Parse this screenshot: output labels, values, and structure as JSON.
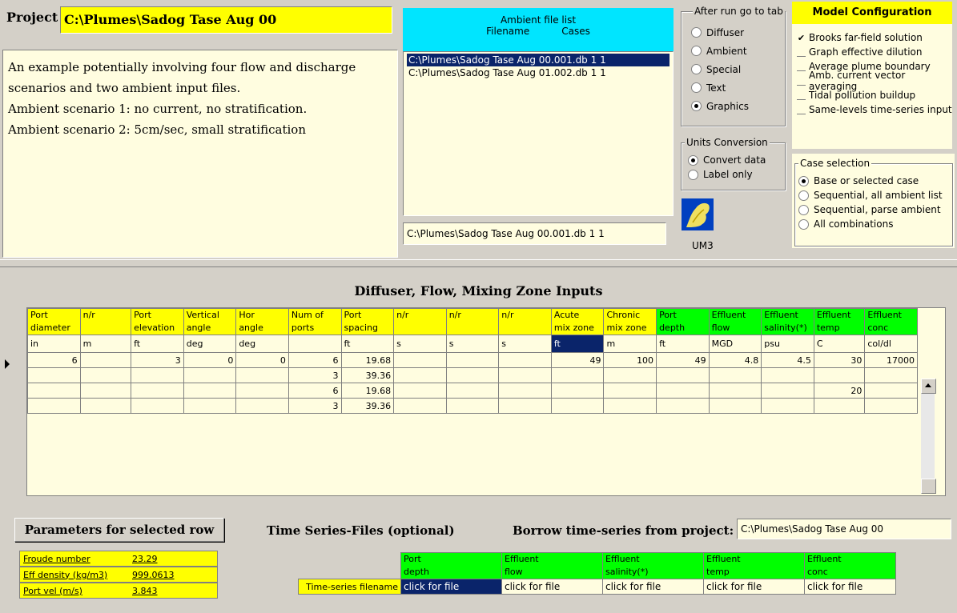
{
  "project": {
    "label": "Project",
    "path": "C:\\Plumes\\Sadog Tase Aug 00",
    "description": [
      "An example potentially involving four flow and discharge",
      "scenarios and two ambient input files.",
      "Ambient scenario 1: no current, no stratification.",
      "Ambient scenario 2: 5cm/sec, small stratification"
    ]
  },
  "ambient_list": {
    "title": "Ambient file list",
    "col_filename": "Filename",
    "col_cases": "Cases",
    "items": [
      "C:\\Plumes\\Sadog Tase Aug 00.001.db 1 1",
      "C:\\Plumes\\Sadog Tase Aug 01.002.db 1 1"
    ],
    "selected_index": 0,
    "current": "C:\\Plumes\\Sadog Tase Aug 00.001.db 1 1"
  },
  "after_run": {
    "title": "After run go to tab",
    "options": [
      "Diffuser",
      "Ambient",
      "Special",
      "Text",
      "Graphics"
    ],
    "selected": "Graphics"
  },
  "units_conversion": {
    "title": "Units Conversion",
    "options": [
      "Convert data",
      "Label only"
    ],
    "selected": "Convert data"
  },
  "um3_label": "UM3",
  "model_config": {
    "title": "Model Configuration",
    "options": [
      {
        "label": "Brooks far-field solution",
        "checked": true
      },
      {
        "label": "Graph effective dilution",
        "checked": false
      },
      {
        "label": "Average plume boundary",
        "checked": false
      },
      {
        "label": "Amb. current vector averaging",
        "checked": false
      },
      {
        "label": "Tidal pollution buildup",
        "checked": false
      },
      {
        "label": "Same-levels time-series input",
        "checked": false
      }
    ]
  },
  "case_selection": {
    "title": "Case selection",
    "options": [
      "Base or selected case",
      "Sequential, all ambient list",
      "Sequential, parse ambient",
      "All combinations"
    ],
    "selected": "Base or selected case"
  },
  "diffuser": {
    "title": "Diffuser, Flow, Mixing Zone Inputs",
    "columns": [
      {
        "h1": "Port",
        "h2": "diameter",
        "unit": "in",
        "color": "#ffff00"
      },
      {
        "h1": "n/r",
        "h2": "",
        "unit": "m",
        "color": "#ffff00"
      },
      {
        "h1": "Port",
        "h2": "elevation",
        "unit": "ft",
        "color": "#ffff00"
      },
      {
        "h1": "Vertical",
        "h2": "angle",
        "unit": "deg",
        "color": "#ffff00"
      },
      {
        "h1": "Hor",
        "h2": "angle",
        "unit": "deg",
        "color": "#ffff00"
      },
      {
        "h1": "Num of",
        "h2": "ports",
        "unit": "",
        "color": "#ffff00"
      },
      {
        "h1": "Port",
        "h2": "spacing",
        "unit": "ft",
        "color": "#ffff00"
      },
      {
        "h1": "n/r",
        "h2": "",
        "unit": "s",
        "color": "#ffff00"
      },
      {
        "h1": "n/r",
        "h2": "",
        "unit": "s",
        "color": "#ffff00"
      },
      {
        "h1": "n/r",
        "h2": "",
        "unit": "s",
        "color": "#ffff00"
      },
      {
        "h1": "Acute",
        "h2": "mix zone",
        "unit": "ft",
        "color": "#ffff00"
      },
      {
        "h1": "Chronic",
        "h2": "mix zone",
        "unit": "m",
        "color": "#ffff00"
      },
      {
        "h1": "Port",
        "h2": "depth",
        "unit": "ft",
        "color": "#00ff00"
      },
      {
        "h1": "Effluent",
        "h2": "flow",
        "unit": "MGD",
        "color": "#00ff00"
      },
      {
        "h1": "Effluent",
        "h2": "salinity(*)",
        "unit": "psu",
        "color": "#00ff00"
      },
      {
        "h1": "Effluent",
        "h2": "temp",
        "unit": "C",
        "color": "#00ff00"
      },
      {
        "h1": "Effluent",
        "h2": "conc",
        "unit": "col/dl",
        "color": "#00ff00"
      }
    ],
    "selected_unit_col": 10,
    "rows": [
      [
        "6",
        "",
        "3",
        "0",
        "0",
        "6",
        "19.68",
        "",
        "",
        "",
        "49",
        "100",
        "49",
        "4.8",
        "4.5",
        "30",
        "17000"
      ],
      [
        "",
        "",
        "",
        "",
        "",
        "3",
        "39.36",
        "",
        "",
        "",
        "",
        "",
        "",
        "",
        "",
        "",
        ""
      ],
      [
        "",
        "",
        "",
        "",
        "",
        "6",
        "19.68",
        "",
        "",
        "",
        "",
        "",
        "",
        "",
        "",
        "20",
        ""
      ],
      [
        "",
        "",
        "",
        "",
        "",
        "3",
        "39.36",
        "",
        "",
        "",
        "",
        "",
        "",
        "",
        "",
        "",
        ""
      ]
    ]
  },
  "params": {
    "title": "Parameters for selected row",
    "rows": [
      {
        "label": "Froude number",
        "value": "23.29"
      },
      {
        "label": "Eff density (kg/m3)",
        "value": "999.0613"
      },
      {
        "label": "Port vel (m/s)",
        "value": "3.843"
      }
    ]
  },
  "timeseries": {
    "title": "Time Series-Files (optional)",
    "borrow_label": "Borrow time-series from project:",
    "borrow_value": "C:\\Plumes\\Sadog Tase Aug 00",
    "row_label": "Time-series filename",
    "columns": [
      {
        "h1": "Port",
        "h2": "depth"
      },
      {
        "h1": "Effluent",
        "h2": "flow"
      },
      {
        "h1": "Effluent",
        "h2": "salinity(*)"
      },
      {
        "h1": "Effluent",
        "h2": "temp"
      },
      {
        "h1": "Effluent",
        "h2": "conc"
      }
    ],
    "cells": [
      "click for file",
      "click for file",
      "click for file",
      "click for file",
      "click for file"
    ]
  }
}
